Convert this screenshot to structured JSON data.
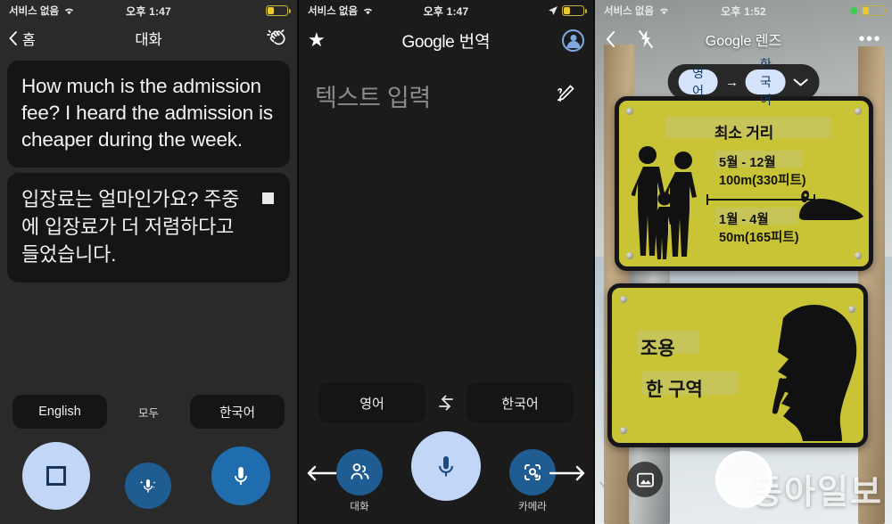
{
  "panel1": {
    "status": {
      "carrier": "서비스 없음",
      "time": "오후 1:47",
      "wifi_icon": "wifi-icon",
      "battery_icon": "battery-low-power-icon"
    },
    "nav": {
      "back_icon": "chevron-left-icon",
      "back_label": "홈",
      "title": "대화",
      "right_icon": "waving-hand-icon"
    },
    "messages": [
      {
        "lang": "en",
        "text": "How much is the admission fee? I heard the admission is cheaper during the week."
      },
      {
        "lang": "ko",
        "text": "입장료는 얼마인가요? 주중에 입장료가 더 저렴하다고 들었습니다.",
        "indicator": "stop-square-icon"
      }
    ],
    "language_row": {
      "left": "English",
      "middle": "모두",
      "right": "한국어"
    },
    "controls": {
      "stop": {
        "name": "stop-button",
        "icon": "stop-square-icon"
      },
      "auto": {
        "name": "auto-detect-mic-button",
        "icon": "mic-sparkle-icon"
      },
      "mic": {
        "name": "mic-button",
        "icon": "mic-icon"
      }
    }
  },
  "panel2": {
    "status": {
      "carrier": "서비스 없음",
      "time": "오후 1:47",
      "wifi_icon": "wifi-icon",
      "location_icon": "location-arrow-icon",
      "battery_icon": "battery-low-power-icon"
    },
    "nav": {
      "star_icon": "star-icon",
      "title_brand": "Google",
      "title_suffix": "번역",
      "account_icon": "account-avatar-icon"
    },
    "input": {
      "placeholder": "텍스트 입력",
      "pen_icon": "handwriting-icon"
    },
    "languages": {
      "source": "영어",
      "target": "한국어",
      "swap_icon": "swap-arrows-icon"
    },
    "bottom": {
      "conversation_label": "대화",
      "camera_label": "카메라",
      "mic_icon": "mic-icon",
      "conversation_icon": "two-people-icon",
      "camera_icon": "camera-lens-icon",
      "arrow_left_icon": "arrow-left-icon",
      "arrow_right_icon": "arrow-right-icon"
    }
  },
  "panel3": {
    "status": {
      "carrier": "서비스 없음",
      "time": "오후 1:52",
      "wifi_icon": "wifi-icon",
      "camera_active_icon": "green-dot-icon",
      "battery_icon": "battery-low-power-icon"
    },
    "nav": {
      "back_icon": "chevron-left-icon",
      "flash_icon": "flash-off-icon",
      "title_brand": "Google",
      "title_suffix": "렌즈",
      "more_icon": "more-options-icon"
    },
    "language_bar": {
      "source": "영어",
      "arrow": "→",
      "target": "한국어",
      "chevron_icon": "chevron-down-icon"
    },
    "sign_top": {
      "title": "최소 거리",
      "period1": "5월 - 12월",
      "distance1": "100m(330피트)",
      "period2": "1월 - 4월",
      "distance2": "50m(165피트)"
    },
    "sign_bottom": {
      "line1": "조용",
      "line2": "한 구역"
    },
    "controls": {
      "gallery_icon": "gallery-icon",
      "shutter": "shutter-button"
    },
    "watermark": "동아일보"
  }
}
